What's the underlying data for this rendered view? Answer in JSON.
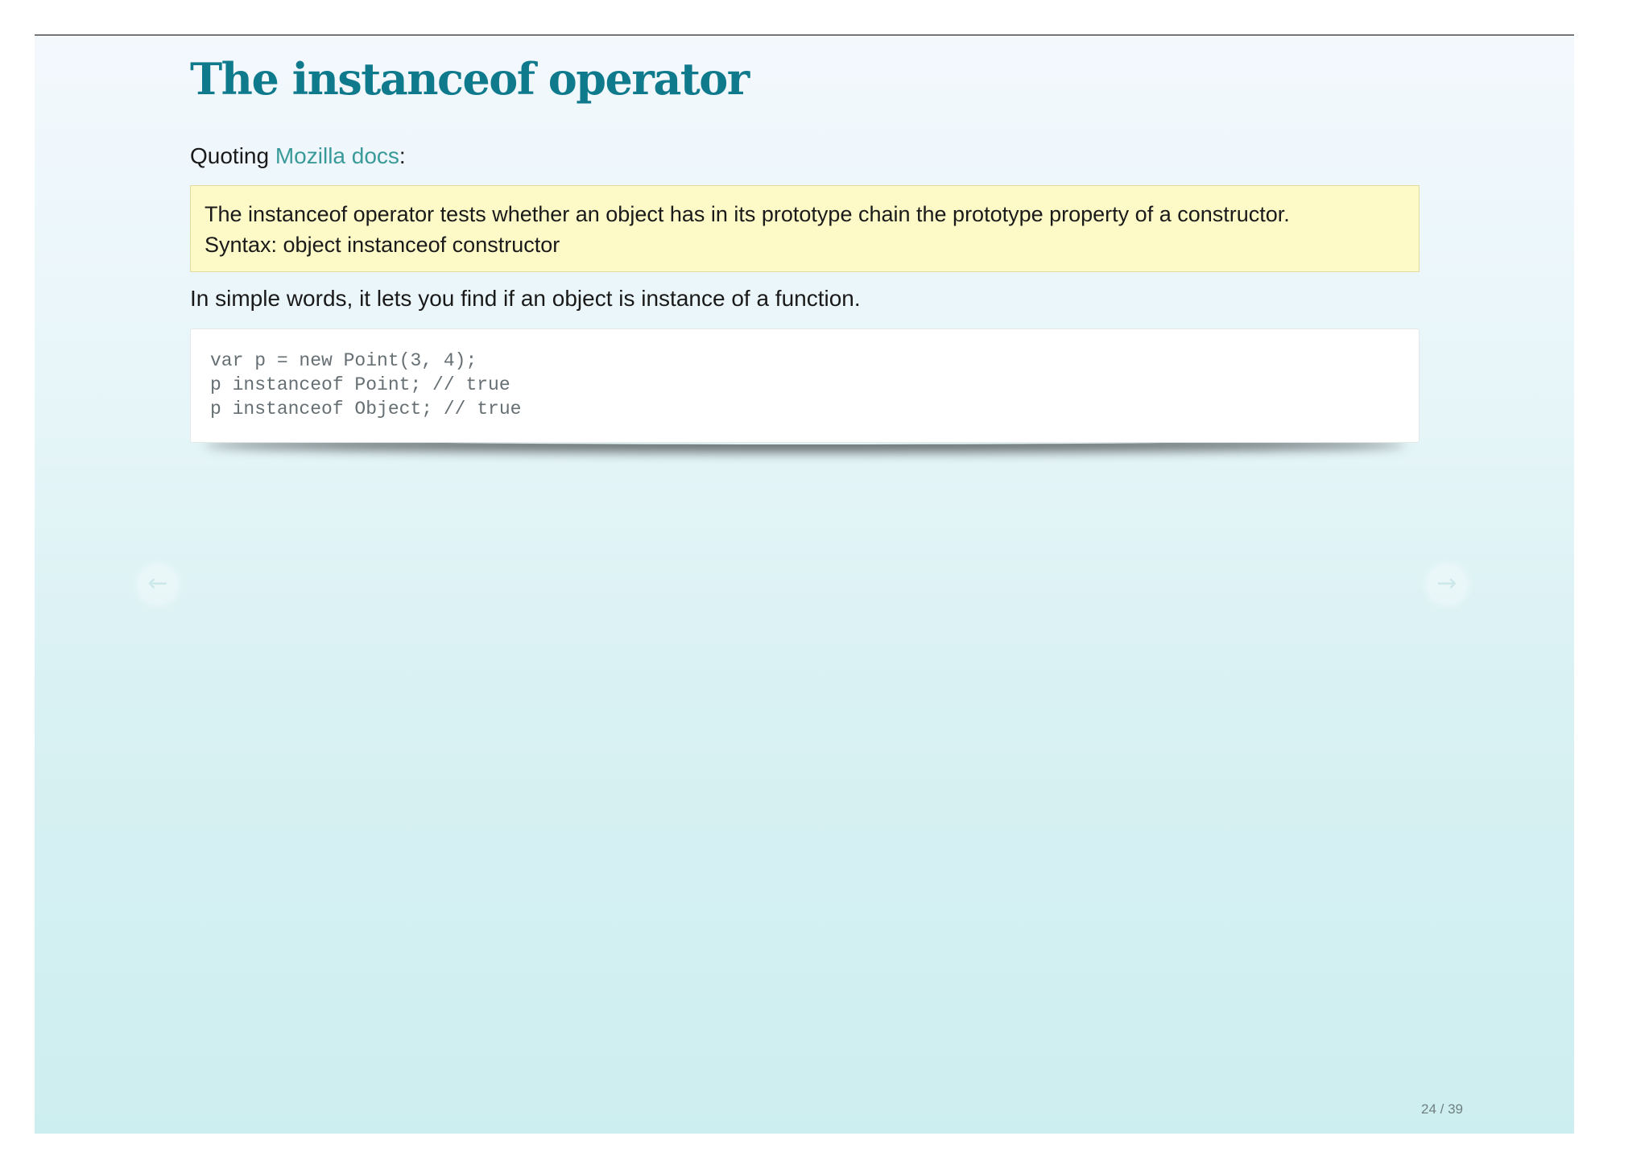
{
  "slide": {
    "title": "The instanceof operator",
    "intro_prefix": "Quoting ",
    "intro_link": "Mozilla docs",
    "intro_suffix": ":",
    "quote_lines": [
      "The instanceof operator tests whether an object has in its prototype chain the prototype property of a constructor.",
      "Syntax: object instanceof constructor"
    ],
    "simple_text": "In simple words, it lets you find if an object is instance of a function.",
    "code_lines": [
      "var p = new Point(3, 4);",
      "p instanceof Point; // true",
      "p instanceof Object; // true"
    ]
  },
  "nav": {
    "prev_icon": "←",
    "next_icon": "→"
  },
  "pager": {
    "text": "24 / 39"
  },
  "colors": {
    "title": "#0f7a8c",
    "link": "#3a9a9a",
    "quote_bg": "#fdfac8"
  }
}
